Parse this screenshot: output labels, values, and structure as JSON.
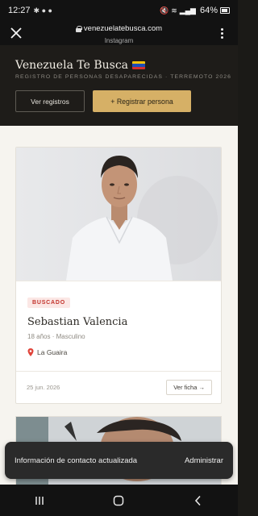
{
  "status_bar": {
    "time": "12:27",
    "battery": "64%"
  },
  "browser": {
    "url": "venezuelatebusca.com",
    "source": "Instagram"
  },
  "site": {
    "title": "Venezuela Te Busca",
    "subtitle": "REGISTRO DE PERSONAS DESAPARECIDAS · TERREMOTO 2026",
    "btn_view": "Ver registros",
    "btn_register": "+ Registrar persona"
  },
  "card": {
    "badge": "BUSCADO",
    "name": "Sebastian Valencia",
    "meta": "18 años · Masculino",
    "location": "La Guaira",
    "date": "25 jun. 2026",
    "view_button": "Ver ficha →"
  },
  "snackbar": {
    "message": "Información de contacto actualizada",
    "action": "Administrar"
  },
  "icons": {
    "close": "close-icon",
    "lock": "lock-icon",
    "menu": "more-vert-icon",
    "pin": "location-pin-icon",
    "nav_recents": "recents-icon",
    "nav_home": "home-icon",
    "nav_back": "back-icon"
  },
  "colors": {
    "header_bg": "#1e1c19",
    "accent_gold": "#d6b066",
    "badge_red": "#c2322b",
    "page_bg": "#f6f4ef"
  }
}
